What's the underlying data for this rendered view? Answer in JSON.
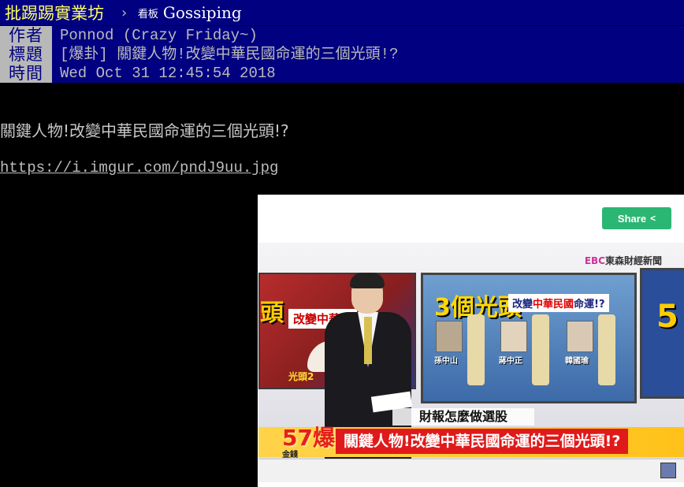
{
  "header": {
    "site_name": "批踢踢實業坊",
    "crumb_arrow": "›",
    "board_label": "看板",
    "board_name": "Gossiping"
  },
  "meta": {
    "author_key": "作者",
    "author_val": "Ponnod (Crazy Friday~)",
    "title_key": "標題",
    "title_val": "[爆卦] 關鍵人物!改變中華民國命運的三個光頭!?",
    "time_key": "時間",
    "time_val": "Wed Oct 31 12:45:54 2018"
  },
  "content": {
    "line1": "關鍵人物!改變中華民國命運的三個光頭!?",
    "link": "https://i.imgur.com/pndJ9uu.jpg"
  },
  "preview": {
    "share_label": "Share",
    "share_icon": "share-icon",
    "video": {
      "channel_logo": "東森財經新聞",
      "channel_logo_prefix": "EBC",
      "left_title": "頭",
      "left_sub": "改變中華民",
      "left_bottom": "光頭2",
      "center_title_num": "3個",
      "center_title_word": "光頭",
      "center_sub_a": "改變",
      "center_sub_b": "中華民國",
      "center_sub_c": "命運!?",
      "person1": "孫中山",
      "person2": "蔣中正",
      "person3": "韓國瑜",
      "right_num": "5",
      "caption": "財報怎麼做選股",
      "show_logo": "57爆",
      "show_logo_sub": "金錢",
      "headline": "關鍵人物!改變中華民國命運的三個光頭!?"
    }
  },
  "colors": {
    "header_bg": "#000080",
    "site_name": "#ffff66",
    "meta_key_bg": "#b8b8b8",
    "share_button": "#2bb673",
    "headline_bg": "#e01a1a"
  }
}
